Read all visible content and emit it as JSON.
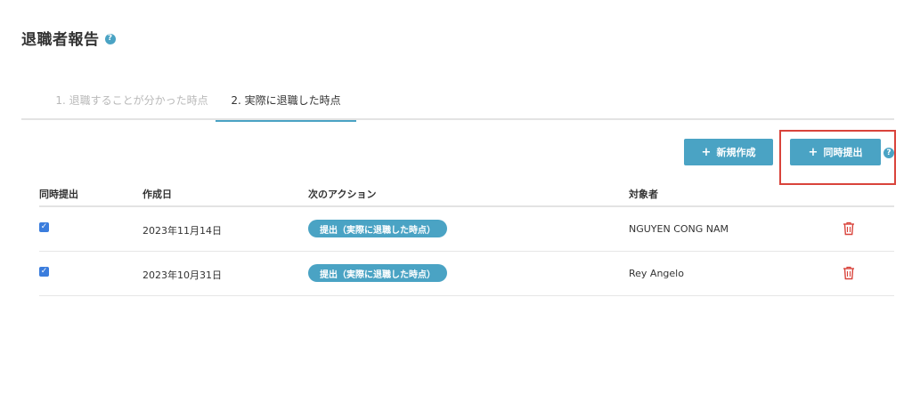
{
  "header": {
    "title": "退職者報告",
    "help_icon": "?"
  },
  "tabs": [
    {
      "label": "1. 退職することが分かった時点",
      "active": false
    },
    {
      "label": "2. 実際に退職した時点",
      "active": true
    }
  ],
  "toolbar": {
    "new_button": {
      "icon": "plus-icon",
      "plus": "+",
      "label": "新規作成"
    },
    "simultaneous_button": {
      "icon": "plus-icon",
      "plus": "+",
      "label": "同時提出"
    },
    "help_icon": "?"
  },
  "table": {
    "headers": [
      "同時提出",
      "作成日",
      "次のアクション",
      "対象者"
    ],
    "rows": [
      {
        "checked": true,
        "check_mark": "✓",
        "created": "2023年11月14日",
        "action": "提出（実際に退職した時点）",
        "person": "NGUYEN CONG NAM"
      },
      {
        "checked": true,
        "check_mark": "✓",
        "created": "2023年10月31日",
        "action": "提出（実際に退職した時点）",
        "person": "Rey Angelo"
      }
    ]
  },
  "colors": {
    "accent": "#4aa3c4",
    "danger": "#d9433b",
    "checkbox": "#3b7ddd",
    "highlight": "#d9433b"
  }
}
